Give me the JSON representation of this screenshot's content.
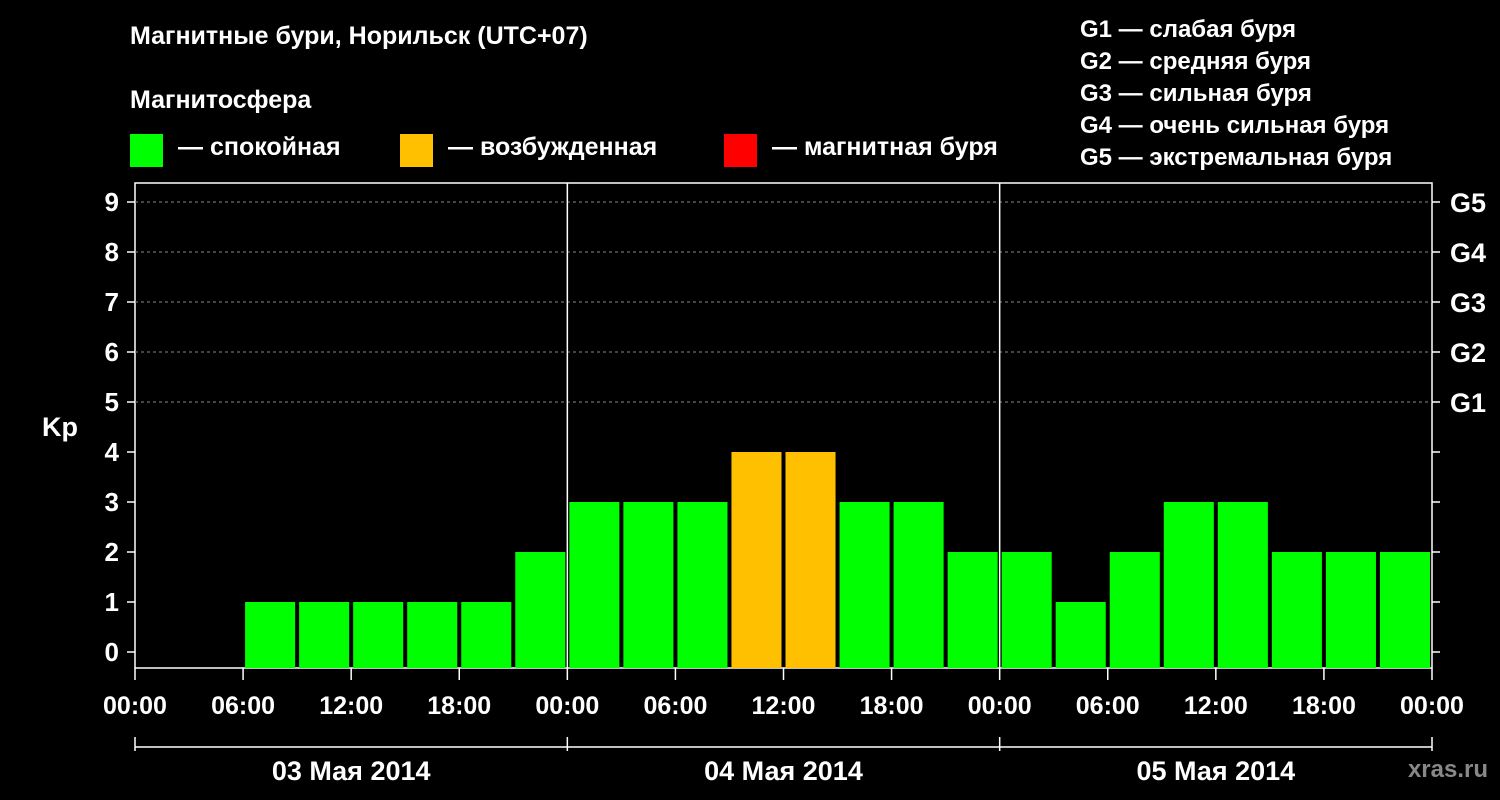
{
  "title": "Магнитные бури, Норильск (UTC+07)",
  "subtitle": "Магнитосфера",
  "legend": [
    {
      "label": "— спокойная",
      "color": "#00ff00"
    },
    {
      "label": "— возбужденная",
      "color": "#ffc000"
    },
    {
      "label": "— магнитная буря",
      "color": "#ff0000"
    }
  ],
  "storm_scale": [
    "G1 — слабая буря",
    "G2 — средняя буря",
    "G3 — сильная буря",
    "G4 — очень сильная буря",
    "G5 — экстремальная буря"
  ],
  "watermark": "xras.ru",
  "chart_data": {
    "type": "bar",
    "title": "Магнитные бури, Норильск (UTC+07)",
    "ylabel": "Kp",
    "ylim": [
      0,
      9
    ],
    "yticks": [
      "0",
      "1",
      "2",
      "3",
      "4",
      "5",
      "6",
      "7",
      "8",
      "9"
    ],
    "right_ticks": [
      {
        "value": 5,
        "label": "G1"
      },
      {
        "value": 6,
        "label": "G2"
      },
      {
        "value": 7,
        "label": "G3"
      },
      {
        "value": 8,
        "label": "G4"
      },
      {
        "value": 9,
        "label": "G5"
      }
    ],
    "xtick_labels": [
      "00:00",
      "06:00",
      "12:00",
      "18:00",
      "00:00",
      "06:00",
      "12:00",
      "18:00",
      "00:00",
      "06:00",
      "12:00",
      "18:00",
      "00:00"
    ],
    "days": [
      "03 Мая 2014",
      "04 Мая 2014",
      "05 Мая 2014"
    ],
    "interval_hours": 3,
    "values": [
      0,
      0,
      1,
      1,
      1,
      1,
      1,
      2,
      3,
      3,
      3,
      4,
      4,
      3,
      3,
      2,
      2,
      1,
      2,
      3,
      3,
      2,
      2,
      2
    ],
    "colors": {
      "quiet": "#00ff00",
      "active": "#ffc000",
      "storm": "#ff0000"
    },
    "grid": true
  }
}
